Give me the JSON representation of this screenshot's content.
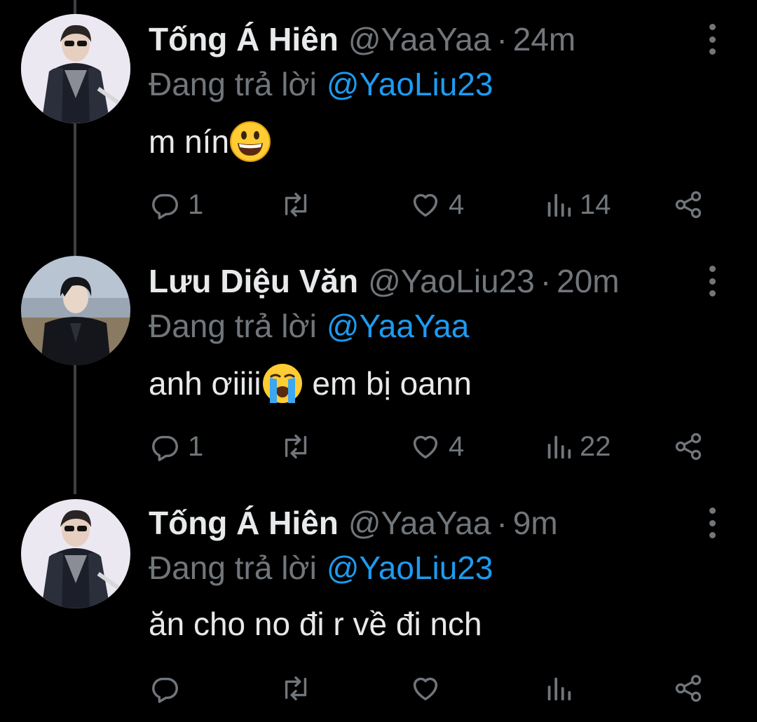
{
  "tweets": [
    {
      "display_name": "Tống Á Hiên",
      "handle": "@YaaYaa",
      "separator": "·",
      "time": "24m",
      "reply_prefix": "Đang trả lời",
      "reply_to": "@YaoLiu23",
      "text_before": "m nín",
      "emoji": "grinning-face",
      "text_after": "",
      "replies": "1",
      "retweets": "",
      "likes": "4",
      "views": "14"
    },
    {
      "display_name": "Lưu Diệu Văn",
      "handle": "@YaoLiu23",
      "separator": "·",
      "time": "20m",
      "reply_prefix": "Đang trả lời",
      "reply_to": "@YaaYaa",
      "text_before": "anh ơiiii",
      "emoji": "loudly-crying-face",
      "text_after": " em bị oann",
      "replies": "1",
      "retweets": "",
      "likes": "4",
      "views": "22"
    },
    {
      "display_name": "Tống Á Hiên",
      "handle": "@YaaYaa",
      "separator": "·",
      "time": "9m",
      "reply_prefix": "Đang trả lời",
      "reply_to": "@YaoLiu23",
      "text_before": "ăn cho no đi r về đi nch",
      "emoji": "",
      "text_after": "",
      "replies": "",
      "retweets": "",
      "likes": "",
      "views": ""
    }
  ],
  "icons": {
    "reply": "reply-icon",
    "retweet": "retweet-icon",
    "like": "heart-icon",
    "views": "views-icon",
    "share": "share-icon",
    "more": "more-vertical-icon"
  },
  "colors": {
    "background": "#000000",
    "text_primary": "#e7e9ea",
    "text_secondary": "#71767b",
    "mention": "#1d9bf0",
    "thread_line": "#3d4144"
  }
}
